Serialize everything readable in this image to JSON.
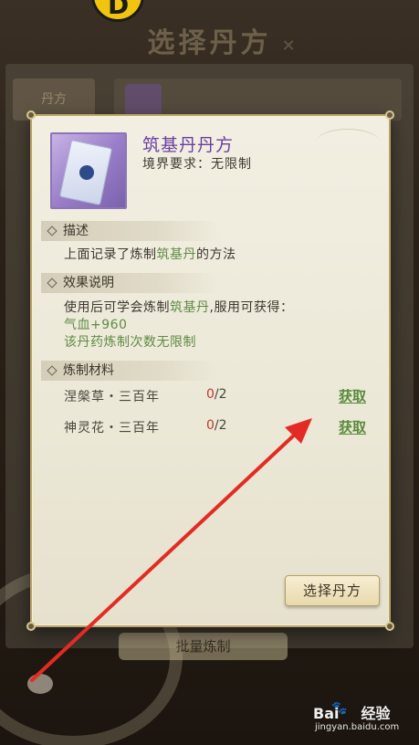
{
  "background": {
    "title": "选择丹方",
    "tab_label": "丹方",
    "bottom_button": "批量炼制"
  },
  "dialog": {
    "item_name": "筑基丹丹方",
    "realm_requirement": "境界要求：无限制",
    "description": {
      "header": "描述",
      "text_before": "上面记录了炼制",
      "text_highlight": "筑基丹",
      "text_after": "的方法"
    },
    "effect": {
      "header": "效果说明",
      "line1_before": "使用后可学会炼制",
      "line1_highlight": "筑基丹",
      "line1_after": ",服用可获得：",
      "line2": "气血+960",
      "line3": "该丹药炼制次数无限制"
    },
    "materials": {
      "header": "炼制材料",
      "items": [
        {
          "name": "涅槃草・三百年",
          "have": "0",
          "need": "/2",
          "action": "获取"
        },
        {
          "name": "神灵花・三百年",
          "have": "0",
          "need": "/2",
          "action": "获取"
        }
      ]
    },
    "select_button": "选择丹方"
  },
  "watermark": {
    "brand_a": "Bai",
    "brand_b": "经验",
    "url": "jingyan.baidu.com"
  },
  "colors": {
    "title_purple": "#6a3fa0",
    "highlight_green": "#5f8a45",
    "count_red": "#c0392b",
    "annotation_red": "#e32b24",
    "dialog_bg": "#f2efe2"
  }
}
